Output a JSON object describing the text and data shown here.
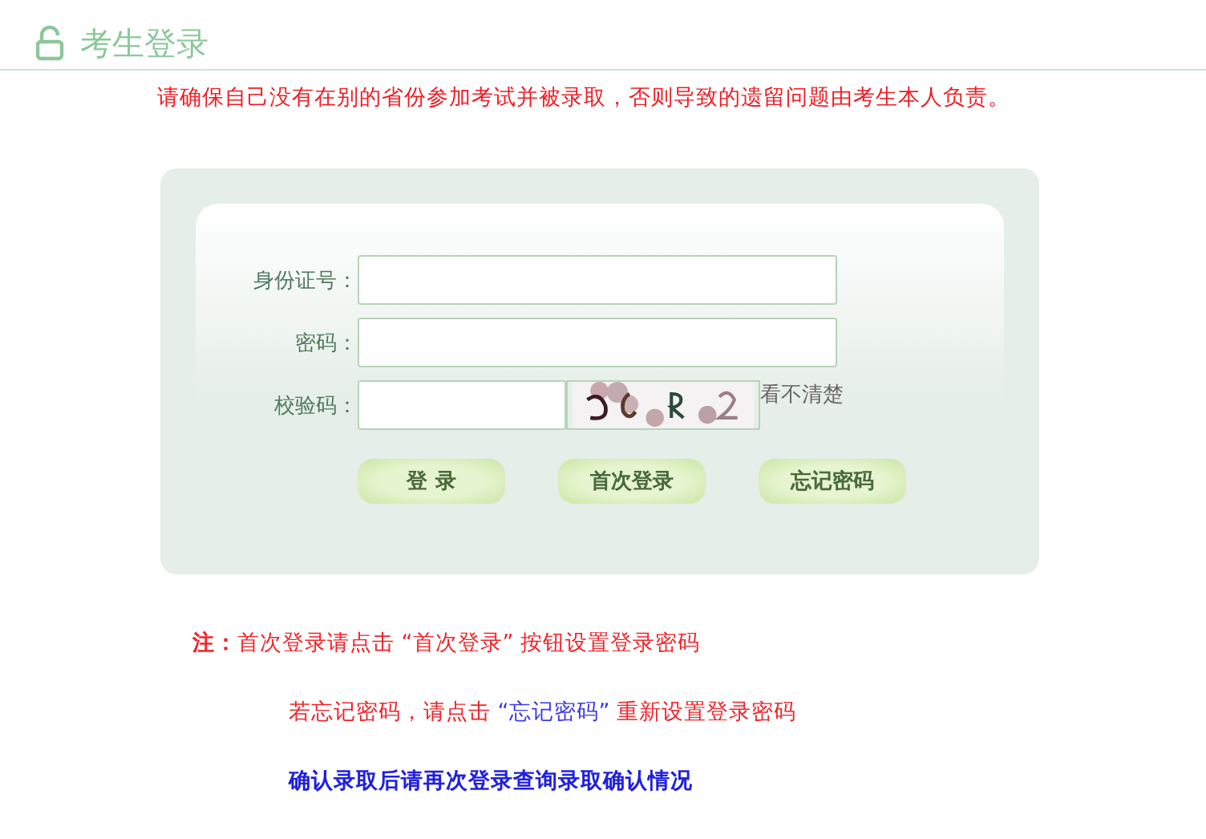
{
  "header": {
    "title": "考生登录"
  },
  "warning": "请确保自己没有在别的省份参加考试并被录取，否则导致的遗留问题由考生本人负责。",
  "form": {
    "fields": [
      {
        "label": "身份证号：",
        "kind": "text"
      },
      {
        "label": "密码：",
        "kind": "password"
      },
      {
        "label": "校验码：",
        "kind": "captcha",
        "refresh_link": "看不清楚"
      }
    ],
    "buttons": [
      "登 录",
      "首次登录",
      "忘记密码"
    ]
  },
  "notes": [
    {
      "kind": "red",
      "segments": [
        {
          "kind": "plain",
          "text": "**注：**首次登录请点击 “首次登录” 按钮设置登录密码"
        }
      ]
    },
    {
      "kind": "red",
      "segments": [
        {
          "kind": "plain",
          "text": "若忘记密码，请点击 "
        },
        {
          "kind": "link",
          "text": "“忘记密码”"
        },
        {
          "kind": "plain",
          "text": " 重新设置登录密码"
        }
      ]
    },
    {
      "kind": "blue",
      "segments": [
        {
          "kind": "plain",
          "text": "确认录取后请再次登录查询录取确认情况"
        }
      ]
    }
  ]
}
